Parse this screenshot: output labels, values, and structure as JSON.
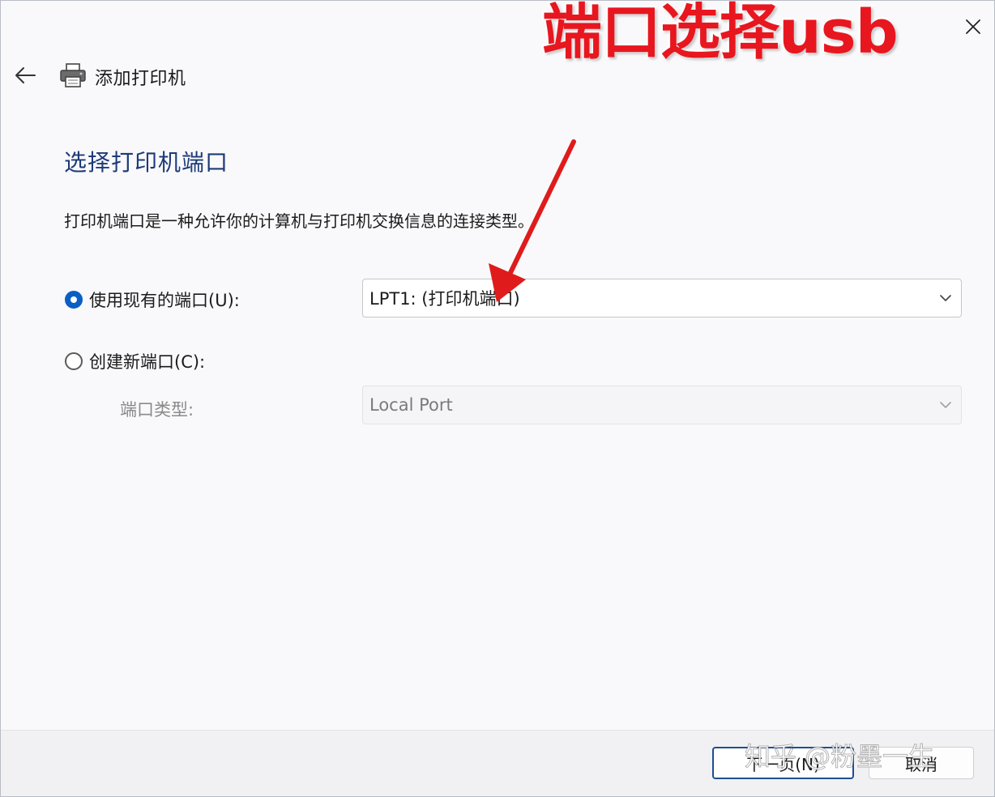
{
  "window": {
    "title": "添加打印机",
    "back_icon": "back-arrow-icon",
    "printer_icon": "printer-icon",
    "close_icon": "close-icon"
  },
  "annotation": {
    "caption": "端口选择usb",
    "caption_color": "#e8161f",
    "arrow_color": "#e01b1b"
  },
  "page": {
    "heading": "选择打印机端口",
    "description": "打印机端口是一种允许你的计算机与打印机交换信息的连接类型。"
  },
  "options": {
    "existing_port": {
      "label": "使用现有的端口(U):",
      "checked": true,
      "selected_value": "LPT1: (打印机端口)"
    },
    "new_port": {
      "label": "创建新端口(C):",
      "checked": false,
      "type_label": "端口类型:",
      "type_value": "Local Port"
    }
  },
  "footer": {
    "next_label": "下一页(N)",
    "cancel_label": "取消"
  },
  "watermark": "知乎 @粉墨一生",
  "colors": {
    "heading": "#1d3a78",
    "radio_accent": "#0a5fc4",
    "primary_border": "#1d4f91"
  }
}
